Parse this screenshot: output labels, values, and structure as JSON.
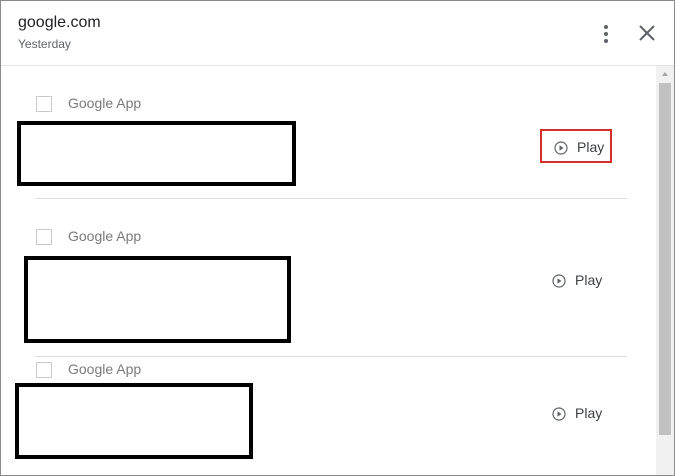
{
  "header": {
    "title": "google.com",
    "subtitle": "Yesterday",
    "more_icon": "more-vert-icon",
    "close_icon": "close-icon"
  },
  "entries": [
    {
      "label": "Google App",
      "play_label": "Play",
      "highlighted": true
    },
    {
      "label": "Google App",
      "play_label": "Play",
      "highlighted": false
    },
    {
      "label": "Google App",
      "play_label": "Play",
      "highlighted": false
    }
  ],
  "colors": {
    "highlight": "#d32f2f",
    "redaction": "#000000"
  }
}
